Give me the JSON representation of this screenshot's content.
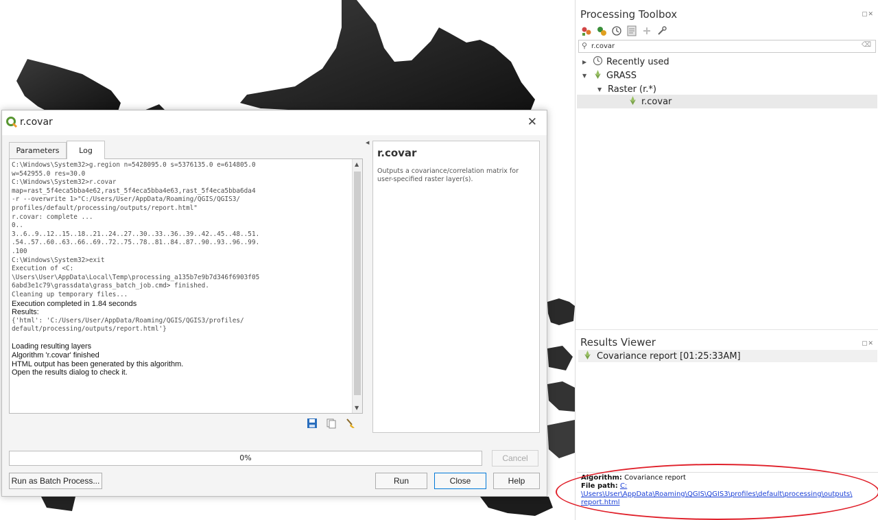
{
  "dialog": {
    "title": "r.covar",
    "tabs": [
      {
        "label": "Parameters"
      },
      {
        "label": "Log"
      }
    ],
    "log_lines": [
      {
        "text": "C:\\Windows\\System32>g.region n=5428095.0 s=5376135.0 e=614805.0",
        "style": "mono"
      },
      {
        "text": "w=542955.0 res=30.0",
        "style": "mono"
      },
      {
        "text": "C:\\Windows\\System32>r.covar",
        "style": "mono"
      },
      {
        "text": "map=rast_5f4eca5bba4e62,rast_5f4eca5bba4e63,rast_5f4eca5bba6da4",
        "style": "mono"
      },
      {
        "text": "-r --overwrite 1>\"C:/Users/User/AppData/Roaming/QGIS/QGIS3/",
        "style": "mono"
      },
      {
        "text": "profiles/default/processing/outputs/report.html\"",
        "style": "mono"
      },
      {
        "text": "r.covar: complete ...",
        "style": "mono"
      },
      {
        "text": "0..",
        "style": "mono"
      },
      {
        "text": "3..6..9..12..15..18..21..24..27..30..33..36..39..42..45..48..51.",
        "style": "mono"
      },
      {
        "text": ".54..57..60..63..66..69..72..75..78..81..84..87..90..93..96..99.",
        "style": "mono"
      },
      {
        "text": ".100",
        "style": "mono"
      },
      {
        "text": "C:\\Windows\\System32>exit",
        "style": "mono"
      },
      {
        "text": "Execution of <C:",
        "style": "mono"
      },
      {
        "text": "\\Users\\User\\AppData\\Local\\Temp\\processing_a135b7e9b7d346f6903f05",
        "style": "mono"
      },
      {
        "text": "6abd3e1c79\\grassdata\\grass_batch_job.cmd> finished.",
        "style": "mono"
      },
      {
        "text": "Cleaning up temporary files...",
        "style": "mono"
      },
      {
        "text": "Execution completed in 1.84 seconds",
        "style": "sans"
      },
      {
        "text": "Results:",
        "style": "sans"
      },
      {
        "text": "{'html': 'C:/Users/User/AppData/Roaming/QGIS/QGIS3/profiles/",
        "style": "mono"
      },
      {
        "text": "default/processing/outputs/report.html'}",
        "style": "mono"
      },
      {
        "text": "",
        "style": "gap"
      },
      {
        "text": "Loading resulting layers",
        "style": "sans"
      },
      {
        "text": "Algorithm 'r.covar' finished",
        "style": "sans"
      },
      {
        "text": "HTML output has been generated by this algorithm.",
        "style": "sans"
      },
      {
        "text": "Open the results dialog to check it.",
        "style": "sans"
      }
    ],
    "help": {
      "title": "r.covar",
      "description": "Outputs a covariance/correlation matrix for user-specified raster layer(s)."
    },
    "progress": {
      "value": 0,
      "label": "0%"
    },
    "buttons": {
      "cancel": "Cancel",
      "batch": "Run as Batch Process...",
      "run": "Run",
      "close": "Close",
      "help": "Help"
    }
  },
  "toolbox": {
    "title": "Processing Toolbox",
    "search_value": "r.covar",
    "tree": [
      {
        "label": "Recently used",
        "icon": "clock-icon",
        "expanded": false
      },
      {
        "label": "GRASS",
        "icon": "grass-icon",
        "expanded": true
      },
      {
        "label": "Raster (r.*)",
        "icon": "none",
        "expanded": true
      },
      {
        "label": "r.covar",
        "icon": "grass-icon",
        "selected": true
      }
    ]
  },
  "results_viewer": {
    "title": "Results Viewer",
    "items": [
      {
        "label": "Covariance report [01:25:33AM]",
        "icon": "grass-icon"
      }
    ],
    "detail": {
      "algorithm_label": "Algorithm:",
      "algorithm_value": "Covariance report",
      "filepath_label": "File path:",
      "filepath_link_line1": "C:",
      "filepath_link_line2": "\\Users\\User\\AppData\\Roaming\\QGIS\\QGIS3\\profiles\\default\\processing\\outputs\\",
      "filepath_link_line3": "report.html"
    }
  },
  "colors": {
    "accent_focus": "#0078d7",
    "annotation_red": "#e0202a",
    "link_blue": "#1a3fd6",
    "selection_gray": "#e9e9e9"
  }
}
